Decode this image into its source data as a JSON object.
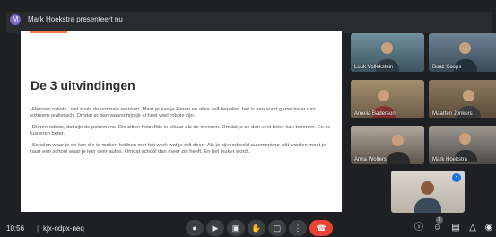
{
  "header": {
    "presenter_initial": "M",
    "presenter_text": "Mark Hoekstra presenteert nu"
  },
  "slide": {
    "title": "De 3 uitvindingen",
    "paragraphs": [
      "-Mensen robots , net zoals de normale mensen. Maar je kan je kleren en alles zelf bepalen. het is een soort game maar dan extreem realistisch. Omdat er dan waarschijnlijk al heel veel robots zijn.",
      "-Dieren robots, dat zijn de pokemons. Die zitten hetzelfde in elkaar als de mensen. Omdat je ze dan veel beter kan temmen. En ze luisteren beter.",
      "-Scholen waar je op kan die te maken hebben met het werk wat je wilt doen. Als je bijvoorbeeld automonteur wilt worden moet je naar een school waar je leer over autos. Omdat school dan meer zin heeft. En het leuker wordt."
    ],
    "accent_color": "#e8824a"
  },
  "participants": [
    {
      "name": "Luuk Vollekstein"
    },
    {
      "name": "Boaz Koops"
    },
    {
      "name": "Amelia Baderson"
    },
    {
      "name": "Maarten Jonkers"
    },
    {
      "name": "Anna Wolters"
    },
    {
      "name": "Mark Hoekstra"
    }
  ],
  "self_view": {
    "icon": "audio-indicator-icon"
  },
  "footer": {
    "time": "10:56",
    "separator": "|",
    "meeting_code": "kjx-odpx-neq",
    "participant_count": "6"
  },
  "colors": {
    "end_call": "#ea4335",
    "badge": "#1a73e8"
  }
}
